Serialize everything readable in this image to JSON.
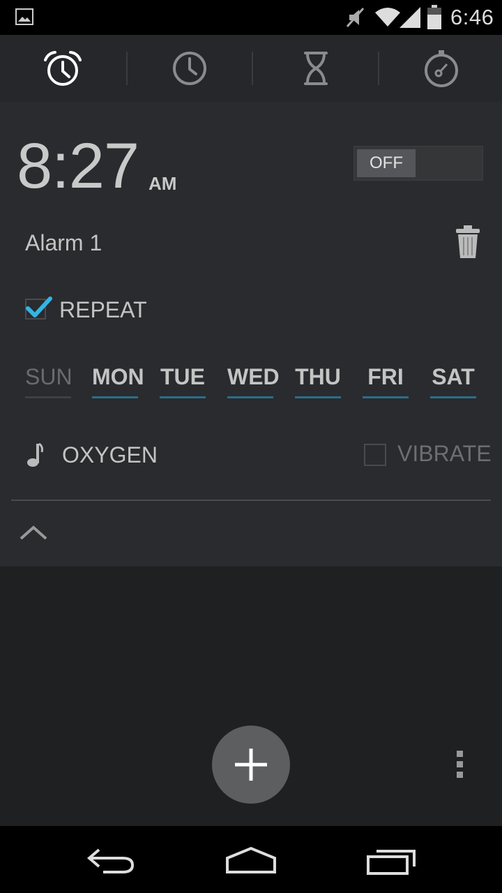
{
  "status_bar": {
    "time": "6:46",
    "icons": [
      "gallery-icon",
      "mute-icon",
      "wifi-icon",
      "signal-icon",
      "battery-icon"
    ]
  },
  "tabs": [
    {
      "name": "alarm",
      "icon": "alarm-clock-icon",
      "selected": true
    },
    {
      "name": "clock",
      "icon": "clock-icon",
      "selected": false
    },
    {
      "name": "timer",
      "icon": "hourglass-icon",
      "selected": false
    },
    {
      "name": "stopwatch",
      "icon": "stopwatch-icon",
      "selected": false
    }
  ],
  "alarm": {
    "time": "8:27",
    "ampm": "AM",
    "toggle_label": "OFF",
    "enabled": false,
    "label": "Alarm 1",
    "repeat_label": "REPEAT",
    "repeat_checked": true,
    "days": [
      {
        "label": "SUN",
        "active": false
      },
      {
        "label": "MON",
        "active": true
      },
      {
        "label": "TUE",
        "active": true
      },
      {
        "label": "WED",
        "active": true
      },
      {
        "label": "THU",
        "active": true
      },
      {
        "label": "FRI",
        "active": true
      },
      {
        "label": "SAT",
        "active": true
      }
    ],
    "ringtone": "OXYGEN",
    "vibrate_label": "VIBRATE",
    "vibrate_checked": false
  },
  "colors": {
    "accent": "#33b5e5",
    "day_underline": "#2a6e8a",
    "background": "#1f2022",
    "card": "#2a2b2e"
  }
}
